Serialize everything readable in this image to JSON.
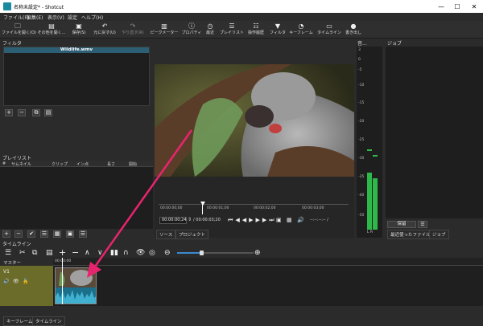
{
  "window": {
    "title": "名称未設定* - Shotcut",
    "controls": [
      "—",
      "☐",
      "✕"
    ]
  },
  "menu": [
    "ファイル(F)",
    "編集(E)",
    "表示(V)",
    "設定",
    "ヘルプ(H)"
  ],
  "toolbar": [
    {
      "label": "ファイルを開く(O)",
      "icon": "🗀"
    },
    {
      "label": "その他を開く...",
      "icon": "▤"
    },
    {
      "label": "保存(S)",
      "icon": "▣"
    },
    {
      "label": "元に戻す(U)",
      "icon": "↶"
    },
    {
      "label": "やり直す(R)",
      "icon": "↷"
    },
    {
      "label": "ピークメーター",
      "icon": "▥"
    },
    {
      "label": "プロパティ",
      "icon": "ⓘ"
    },
    {
      "label": "最近",
      "icon": "◷"
    },
    {
      "label": "プレイリスト",
      "icon": "☰"
    },
    {
      "label": "操作履歴",
      "icon": "☷"
    },
    {
      "label": "フィルタ",
      "icon": "▼"
    },
    {
      "label": "キーフレーム",
      "icon": "◔"
    },
    {
      "label": "タイムライン",
      "icon": "▭"
    },
    {
      "label": "書き出し",
      "icon": "●"
    }
  ],
  "filters": {
    "title": "フィルタ",
    "clip_name": "Wildlife.wmv"
  },
  "playlist": {
    "title": "プレイリスト",
    "columns": [
      "#",
      "サムネイル",
      "クリップ",
      "イン点",
      "長さ",
      "開始"
    ]
  },
  "player": {
    "ruler_labels": [
      "00:00:00;00",
      "00:00:01;00",
      "00:00:02;00",
      "00:00:03;00"
    ],
    "current_time": "00:00:00;24",
    "duration": "/ 00:00:03;20",
    "volume_text": "--:--:--:-- /",
    "tabs": [
      "ソース",
      "プロジェクト"
    ]
  },
  "meter": {
    "title": "音...",
    "scale": [
      "3",
      "0",
      "-5",
      "-10",
      "-15",
      "-20",
      "-25",
      "-30",
      "-35",
      "-40",
      "-50"
    ],
    "labels": "L R",
    "left_level": 0.62,
    "right_level": 0.56,
    "colors": {
      "green": "#2fb84a",
      "dark_green": "#1e6e2e"
    }
  },
  "jobs": {
    "title": "ジョブ",
    "pause_label": "保留",
    "tabs": [
      "最近使ったファイル",
      "ジョブ"
    ]
  },
  "timeline": {
    "title": "タイムライン",
    "master": "マスター",
    "ruler_label": "00:00:00",
    "track_name": "V1",
    "tabs": [
      "キーフレーム",
      "タイムライン"
    ]
  },
  "accent": "#e8246f"
}
